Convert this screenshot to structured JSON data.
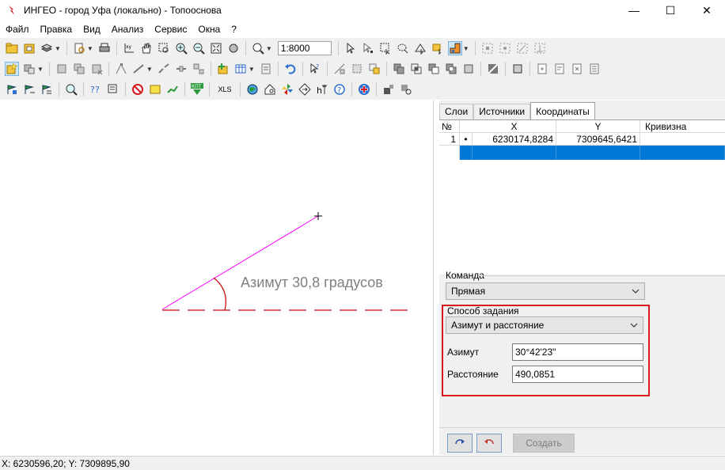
{
  "window": {
    "title": "ИНГЕО - город Уфа (локально) - Топооснова",
    "minimize": "—",
    "maximize": "☐",
    "close": "✕"
  },
  "menu": [
    "Файл",
    "Правка",
    "Вид",
    "Анализ",
    "Сервис",
    "Окна",
    "?"
  ],
  "toolbar": {
    "scale": "1:8000",
    "kpt_label": "КПТ",
    "xls_label": "XLS"
  },
  "canvas": {
    "annotation": "Азимут 30,8 градусов",
    "line_color": "#ff00ff",
    "dash_color": "#cc0000"
  },
  "panel": {
    "tabs": [
      "Слои",
      "Источники",
      "Координаты"
    ],
    "active_tab": "Координаты",
    "grid": {
      "headers": [
        "№",
        "",
        "X",
        "Y",
        "Кривизна"
      ],
      "rows": [
        {
          "num": "1",
          "marker": "•",
          "x": "6230174,8284",
          "y": "7309645,6421",
          "curv": ""
        }
      ]
    },
    "command_label": "Команда",
    "command_value": "Прямая",
    "method_label": "Способ задания",
    "method_value": "Азимут и расстояние",
    "azimuth_label": "Азимут",
    "azimuth_value": "30°42'23\"",
    "distance_label": "Расстояние",
    "distance_value": "490,0851",
    "create_button": "Создать",
    "highlight_color": "#d7191f"
  },
  "status": {
    "coords": "X: 6230596,20; Y: 7309895,90"
  }
}
